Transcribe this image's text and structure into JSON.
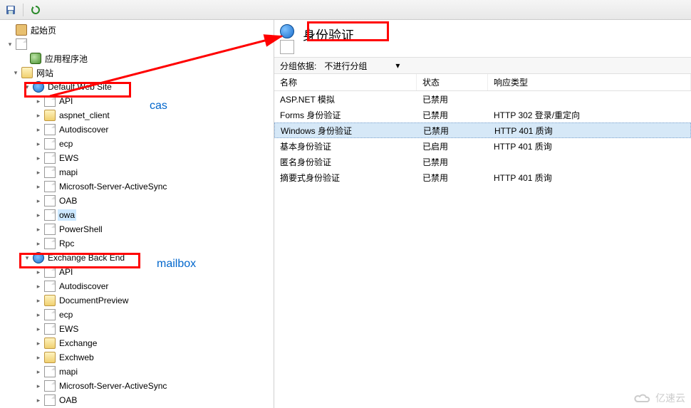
{
  "header": {
    "title": "身份验证"
  },
  "toolbar": {
    "save_icon": "save",
    "refresh_icon": "refresh"
  },
  "groupbar": {
    "label": "分组依据:",
    "value": "不进行分组"
  },
  "list": {
    "cols": {
      "name": "名称",
      "status": "状态",
      "response": "响应类型"
    },
    "rows": [
      {
        "name": "ASP.NET 模拟",
        "status": "已禁用",
        "response": ""
      },
      {
        "name": "Forms 身份验证",
        "status": "已禁用",
        "response": "HTTP 302 登录/重定向"
      },
      {
        "name": "Windows 身份验证",
        "status": "已禁用",
        "response": "HTTP 401 质询",
        "selected": true
      },
      {
        "name": "基本身份验证",
        "status": "已启用",
        "response": "HTTP 401 质询"
      },
      {
        "name": "匿名身份验证",
        "status": "已禁用",
        "response": ""
      },
      {
        "name": "摘要式身份验证",
        "status": "已禁用",
        "response": "HTTP 401 质询"
      }
    ]
  },
  "tree": {
    "start": "起始页",
    "server": "",
    "apppool": "应用程序池",
    "sites": "网站",
    "dws": "Default Web Site",
    "dws_children": [
      "API",
      "aspnet_client",
      "Autodiscover",
      "ecp",
      "EWS",
      "mapi",
      "Microsoft-Server-ActiveSync",
      "OAB",
      "owa",
      "PowerShell",
      "Rpc"
    ],
    "ebe": "Exchange Back End",
    "ebe_children": [
      "API",
      "Autodiscover",
      "DocumentPreview",
      "ecp",
      "EWS",
      "Exchange",
      "Exchweb",
      "mapi",
      "Microsoft-Server-ActiveSync",
      "OAB"
    ]
  },
  "annotations": {
    "cas": "cas",
    "mailbox": "mailbox"
  },
  "watermark": "亿速云"
}
